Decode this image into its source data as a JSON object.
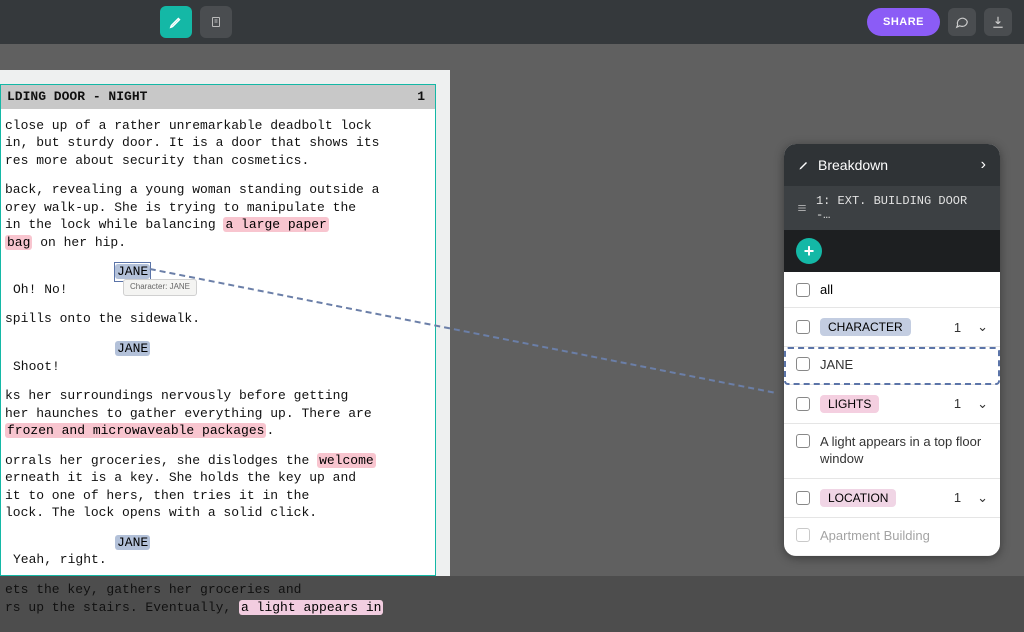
{
  "topbar": {
    "share_label": "SHARE"
  },
  "scene": {
    "heading": "LDING DOOR - NIGHT",
    "number": "1",
    "p1": "close up of a rather unremarkable deadbolt lock\nin, but sturdy door. It is a door that shows its\nres more about security than cosmetics.",
    "p2a": "back, revealing a young woman standing outside a\norey walk-up. She is trying to manipulate the\n in the lock while balancing ",
    "p2_mark1": "a large paper",
    "p2_mark2": "bag",
    "p2b": " on her hip.",
    "cue1": "JANE",
    "dlg1": "Oh! No!",
    "p3": "spills onto the sidewalk.",
    "cue2": "JANE",
    "dlg2": "Shoot!",
    "p4a": "ks her surroundings nervously before getting\nher haunches to gather everything up. There are\n ",
    "p4_mark": "frozen and microwaveable packages",
    "p4b": ".",
    "p5a": "orrals her groceries, she dislodges the ",
    "p5_mark": "welcome",
    "p5b": "\nerneath it is a key. She holds the key up and\n it to one of hers, then tries it in the\n lock. The lock opens with a solid click.",
    "cue3": "JANE",
    "dlg3": "Yeah, right.",
    "p6a": "ets the key, gathers her groceries and\nrs up the stairs. Eventually, ",
    "p6_mark": "a light appears in",
    "tooltip": "Character: JANE"
  },
  "panel": {
    "title": "Breakdown",
    "sub": "1: EXT. BUILDING DOOR -…",
    "all": "all",
    "cat1": {
      "label": "CHARACTER",
      "count": "1"
    },
    "item1": "JANE",
    "cat2": {
      "label": "LIGHTS",
      "count": "1"
    },
    "item2": "A light appears in a top floor window",
    "cat3": {
      "label": "LOCATION",
      "count": "1"
    },
    "item3": "Apartment Building"
  }
}
